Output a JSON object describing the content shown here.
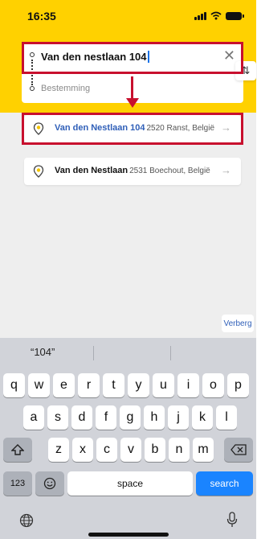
{
  "status_bar": {
    "time": "16:35"
  },
  "search": {
    "origin_value": "Van den nestlaan 104",
    "destination_placeholder": "Bestemming",
    "clear_icon": "close-icon",
    "swap_icon": "swap-icon"
  },
  "results": [
    {
      "name": "Van den Nestlaan 104",
      "detail": "2520 Ranst, België",
      "icon": "location-pin-icon"
    },
    {
      "name": "Van den Nestlaan",
      "detail": "2531 Boechout, België",
      "icon": "location-pin-icon"
    }
  ],
  "hide_button_label": "Verberg",
  "keyboard": {
    "suggestion": "“104”",
    "row1": [
      "q",
      "w",
      "e",
      "r",
      "t",
      "y",
      "u",
      "i",
      "o",
      "p"
    ],
    "row2": [
      "a",
      "s",
      "d",
      "f",
      "g",
      "h",
      "j",
      "k",
      "l"
    ],
    "row3": [
      "z",
      "x",
      "c",
      "v",
      "b",
      "n",
      "m"
    ],
    "numbers_label": "123",
    "space_label": "space",
    "search_label": "search"
  },
  "colors": {
    "header": "#ffd100",
    "highlight": "#c8102e",
    "link": "#2f5fb8",
    "search_key": "#1a84ff"
  }
}
